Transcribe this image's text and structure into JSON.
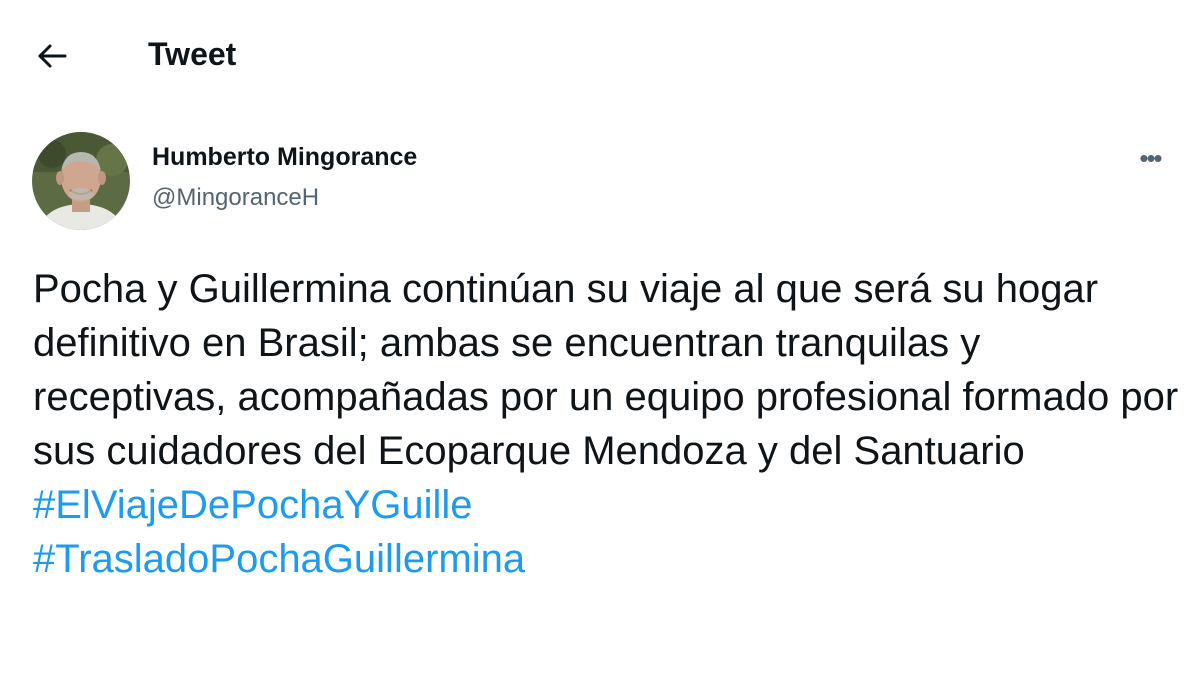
{
  "header": {
    "back_icon": "arrow-left-icon",
    "title": "Tweet"
  },
  "author": {
    "name": "Humberto Mingorance",
    "handle": "@MingoranceH",
    "avatar_icon": "profile-photo",
    "more_icon": "more-horizontal-icon",
    "more_label": "•••"
  },
  "tweet": {
    "text": "Pocha y Guillermina continúan su viaje al que será su hogar definitivo en Brasil; ambas se encuentran tranquilas y receptivas, acompañadas por un equipo profesional formado por sus cuidadores del Ecoparque Mendoza y del Santuario",
    "hashtags": [
      "#ElViajeDePochaYGuille",
      "#TrasladoPochaGuillermina"
    ]
  },
  "colors": {
    "text": "#0f1419",
    "secondary": "#536471",
    "link": "#1d9bf0",
    "background": "#ffffff"
  }
}
